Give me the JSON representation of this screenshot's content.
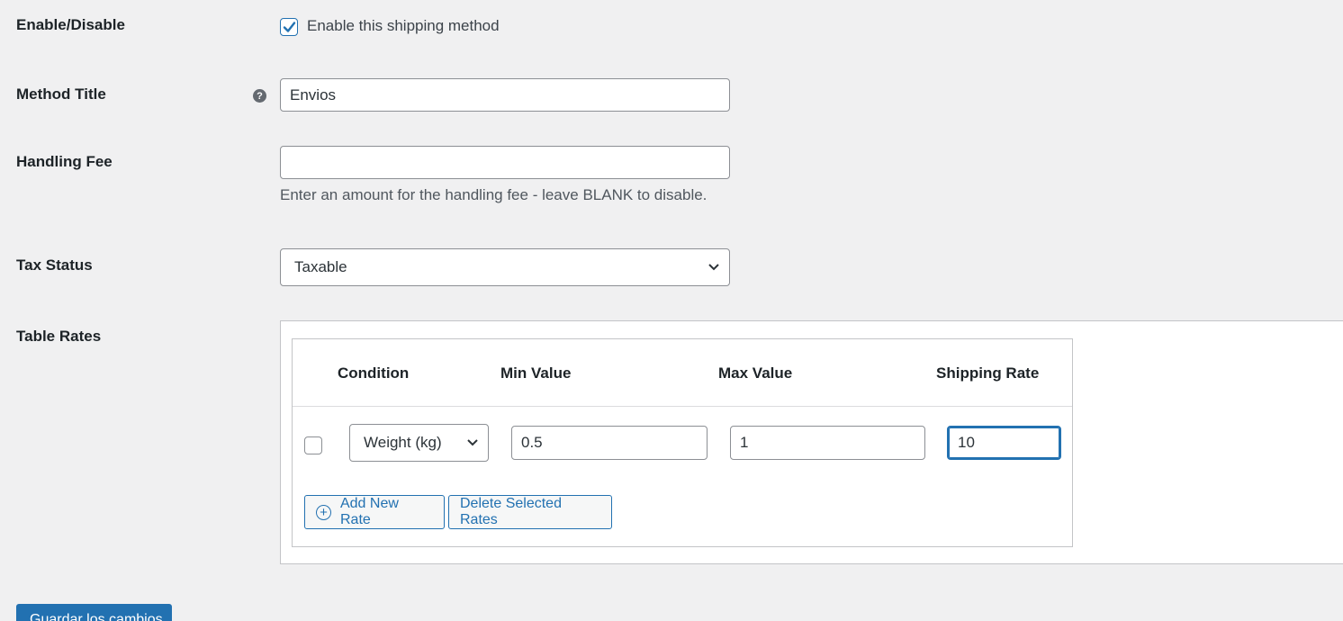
{
  "fields": {
    "enable": {
      "label": "Enable/Disable",
      "checkbox_label": "Enable this shipping method",
      "checked": true
    },
    "method_title": {
      "label": "Method Title",
      "value": "Envios"
    },
    "handling_fee": {
      "label": "Handling Fee",
      "value": "",
      "description": "Enter an amount for the handling fee - leave BLANK to disable."
    },
    "tax_status": {
      "label": "Tax Status",
      "selected": "Taxable"
    },
    "table_rates": {
      "label": "Table Rates"
    }
  },
  "rates_table": {
    "headers": [
      "Condition",
      "Min Value",
      "Max Value",
      "Shipping Rate"
    ],
    "rows": [
      {
        "checked": false,
        "condition": "Weight (kg)",
        "min": "0.5",
        "max": "1",
        "rate": "10"
      }
    ],
    "add_button": "Add New Rate",
    "delete_button": "Delete Selected Rates"
  },
  "save_button": "Guardar los cambios",
  "colors": {
    "accent": "#2271b1",
    "background": "#f0f0f1"
  },
  "icons": {
    "help": "question-circle-icon",
    "dropdown": "chevron-down-icon",
    "check": "checkmark-icon",
    "add": "plus-circle-icon"
  }
}
